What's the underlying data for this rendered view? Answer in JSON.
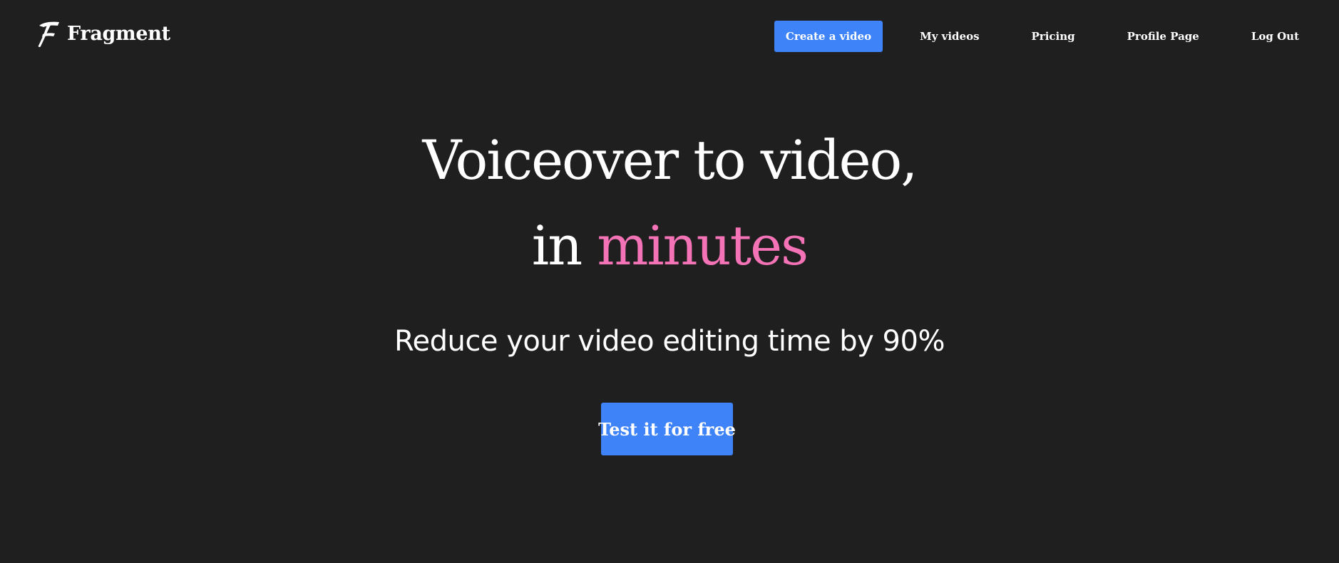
{
  "brand": {
    "name": "Fragment",
    "logo_icon": "f-logo-icon"
  },
  "nav": {
    "create_label": "Create a video",
    "my_videos_label": "My videos",
    "pricing_label": "Pricing",
    "profile_label": "Profile Page",
    "logout_label": "Log Out"
  },
  "hero": {
    "line1": "Voiceover to video,",
    "line2_prefix": "in ",
    "line2_accent": "minutes",
    "subtitle": "Reduce your video editing time by 90%",
    "cta_label": "Test it for free"
  },
  "colors": {
    "background": "#1f1f1f",
    "primary": "#3f83f8",
    "accent": "#f472b6",
    "text": "#ffffff"
  }
}
